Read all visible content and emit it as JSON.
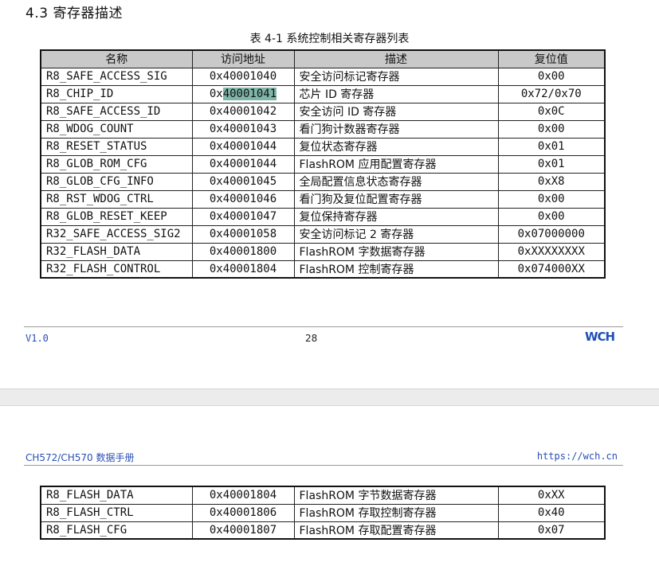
{
  "section_heading": "4.3 寄存器描述",
  "table_caption": "表 4-1 系统控制相关寄存器列表",
  "table_headers": [
    "名称",
    "访问地址",
    "描述",
    "复位值"
  ],
  "rows": [
    {
      "name": "R8_SAFE_ACCESS_SIG",
      "addr": "0x40001040",
      "desc": "安全访问标记寄存器",
      "reset": "0x00"
    },
    {
      "name": "R8_CHIP_ID",
      "addr_prefix": "0x",
      "addr_highlight": "40001041",
      "desc": "芯片 ID 寄存器",
      "reset": "0x72/0x70"
    },
    {
      "name": "R8_SAFE_ACCESS_ID",
      "addr": "0x40001042",
      "desc": "安全访问 ID 寄存器",
      "reset": "0x0C"
    },
    {
      "name": "R8_WDOG_COUNT",
      "addr": "0x40001043",
      "desc": "看门狗计数器寄存器",
      "reset": "0x00"
    },
    {
      "name": "R8_RESET_STATUS",
      "addr": "0x40001044",
      "desc": "复位状态寄存器",
      "reset": "0x01"
    },
    {
      "name": "R8_GLOB_ROM_CFG",
      "addr": "0x40001044",
      "desc": "FlashROM 应用配置寄存器",
      "reset": "0x01"
    },
    {
      "name": "R8_GLOB_CFG_INFO",
      "addr": "0x40001045",
      "desc": "全局配置信息状态寄存器",
      "reset": "0xX8"
    },
    {
      "name": "R8_RST_WDOG_CTRL",
      "addr": "0x40001046",
      "desc": "看门狗及复位配置寄存器",
      "reset": "0x00"
    },
    {
      "name": "R8_GLOB_RESET_KEEP",
      "addr": "0x40001047",
      "desc": "复位保持寄存器",
      "reset": "0x00"
    },
    {
      "name": "R32_SAFE_ACCESS_SIG2",
      "addr": "0x40001058",
      "desc": "安全访问标记 2 寄存器",
      "reset": "0x07000000"
    },
    {
      "name": "R32_FLASH_DATA",
      "addr": "0x40001800",
      "desc": "FlashROM 字数据寄存器",
      "reset": "0xXXXXXXXX"
    },
    {
      "name": "R32_FLASH_CONTROL",
      "addr": "0x40001804",
      "desc": "FlashROM 控制寄存器",
      "reset": "0x074000XX"
    }
  ],
  "footer": {
    "version": "V1.0",
    "page_number": "28",
    "logo_text": "WCH"
  },
  "next_page_header": {
    "doc_title": "CH572/CH570 数据手册",
    "url": "https://wch.cn"
  },
  "continued_rows": [
    {
      "name": "R8_FLASH_DATA",
      "addr": "0x40001804",
      "desc": "FlashROM 字节数据寄存器",
      "reset": "0xXX"
    },
    {
      "name": "R8_FLASH_CTRL",
      "addr": "0x40001806",
      "desc": "FlashROM 存取控制寄存器",
      "reset": "0x40"
    },
    {
      "name": "R8_FLASH_CFG",
      "addr": "0x40001807",
      "desc": "FlashROM 存取配置寄存器",
      "reset": "0x07"
    }
  ]
}
